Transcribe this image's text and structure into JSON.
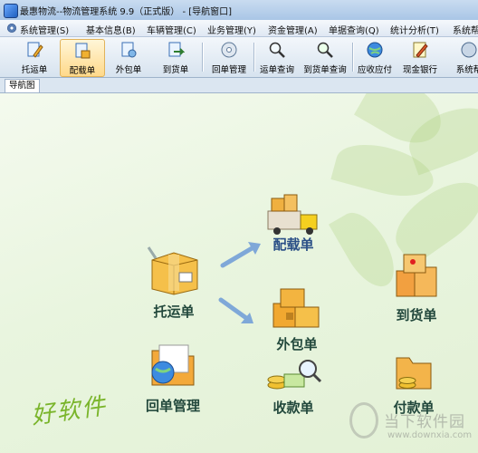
{
  "window": {
    "title": "最惠物流--物流管理系统 9.9（正式版） - [导航窗口]"
  },
  "menu": [
    {
      "label": "系统管理(S)"
    },
    {
      "label": "基本信息(B)"
    },
    {
      "label": "车辆管理(C)"
    },
    {
      "label": "业务管理(Y)"
    },
    {
      "label": "资金管理(A)"
    },
    {
      "label": "单据查询(Q)"
    },
    {
      "label": "统计分析(T)"
    },
    {
      "label": "系统帮"
    }
  ],
  "toolbar": [
    {
      "label": "托运单",
      "icon": "doc-pen-icon"
    },
    {
      "label": "配载单",
      "icon": "doc-box-icon"
    },
    {
      "label": "外包单",
      "icon": "doc-gear-icon"
    },
    {
      "label": "到货单",
      "icon": "doc-arrow-icon"
    },
    {
      "label": "回单管理",
      "icon": "disc-icon"
    },
    {
      "label": "运单查询",
      "icon": "magnifier-icon"
    },
    {
      "label": "到货单查询",
      "icon": "magnifier-green-icon"
    },
    {
      "label": "应收应付",
      "icon": "globe-icon"
    },
    {
      "label": "现金银行",
      "icon": "pencil-icon"
    },
    {
      "label": "系统帮",
      "icon": "help-icon"
    }
  ],
  "tab": {
    "label": "导航图"
  },
  "nav": {
    "consign": "托运单",
    "stowage": "配载单",
    "outsource": "外包单",
    "arrival": "到货单",
    "receipt": "回单管理",
    "collect": "收款单",
    "payment": "付款单"
  },
  "watermark": {
    "text": "当下软件园",
    "url": "www.downxia.com"
  },
  "signature": {
    "text": "好软件"
  },
  "colors": {
    "label_blue": "#2a4f86",
    "label_green": "#22483c",
    "accent": "#ffd98a"
  }
}
